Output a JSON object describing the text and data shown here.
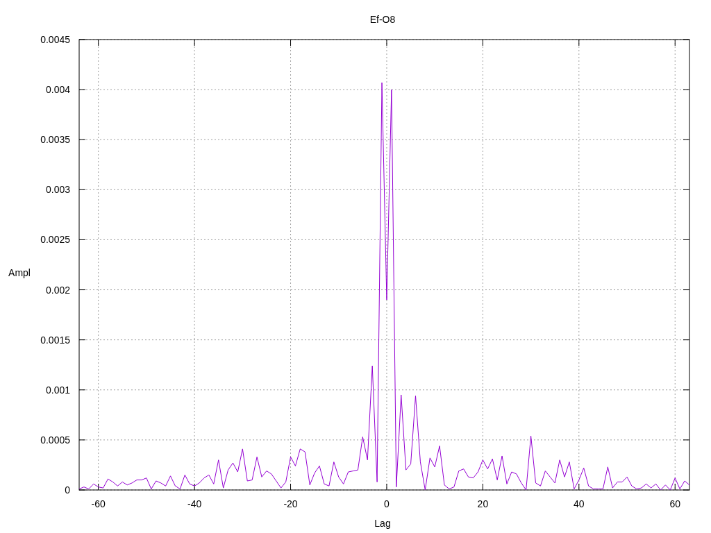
{
  "chart_data": {
    "type": "line",
    "title": "Ef-O8",
    "xlabel": "Lag",
    "ylabel": "Ampl",
    "x": [
      -64,
      -63,
      -62,
      -61,
      -60,
      -59,
      -58,
      -57,
      -56,
      -55,
      -54,
      -53,
      -52,
      -51,
      -50,
      -49,
      -48,
      -47,
      -46,
      -45,
      -44,
      -43,
      -42,
      -41,
      -40,
      -39,
      -38,
      -37,
      -36,
      -35,
      -34,
      -33,
      -32,
      -31,
      -30,
      -29,
      -28,
      -27,
      -26,
      -25,
      -24,
      -23,
      -22,
      -21,
      -20,
      -19,
      -18,
      -17,
      -16,
      -15,
      -14,
      -13,
      -12,
      -11,
      -10,
      -9,
      -8,
      -7,
      -6,
      -5,
      -4,
      -3,
      -2,
      -1,
      0,
      1,
      2,
      3,
      4,
      5,
      6,
      7,
      8,
      9,
      10,
      11,
      12,
      13,
      14,
      15,
      16,
      17,
      18,
      19,
      20,
      21,
      22,
      23,
      24,
      25,
      26,
      27,
      28,
      29,
      30,
      31,
      32,
      33,
      34,
      35,
      36,
      37,
      38,
      39,
      40,
      41,
      42,
      43,
      44,
      45,
      46,
      47,
      48,
      49,
      50,
      51,
      52,
      53,
      54,
      55,
      56,
      57,
      58,
      59,
      60,
      61,
      62,
      63
    ],
    "series": [
      {
        "color": "#9400d3",
        "values": [
          1e-05,
          3e-05,
          1e-05,
          6e-05,
          3e-05,
          2e-05,
          0.00011,
          8e-05,
          4e-05,
          8e-05,
          5e-05,
          7e-05,
          0.0001,
          0.0001,
          0.00012,
          1e-05,
          9e-05,
          7e-05,
          4e-05,
          0.00014,
          4e-05,
          1e-05,
          0.00015,
          6e-05,
          4e-05,
          7e-05,
          0.00012,
          0.00015,
          6e-05,
          0.0003,
          2e-05,
          0.0002,
          0.00027,
          0.00018,
          0.00041,
          9e-05,
          0.0001,
          0.00033,
          0.00013,
          0.00019,
          0.00016,
          9e-05,
          2e-05,
          8e-05,
          0.00033,
          0.00024,
          0.00041,
          0.00038,
          5e-05,
          0.00017,
          0.00024,
          6e-05,
          4e-05,
          0.00028,
          0.00013,
          6e-05,
          0.00018,
          0.00019,
          0.0002,
          0.00053,
          0.0003,
          0.00124,
          8e-05,
          0.00407,
          0.0019,
          0.004,
          3e-05,
          0.00095,
          0.0002,
          0.00026,
          0.00094,
          0.00028,
          0,
          0.00032,
          0.00023,
          0.00044,
          5e-05,
          1e-05,
          3e-05,
          0.00019,
          0.00021,
          0.00013,
          0.00012,
          0.00018,
          0.0003,
          0.00021,
          0.00031,
          0.0001,
          0.00034,
          6e-05,
          0.00018,
          0.00016,
          7e-05,
          0,
          0.00054,
          7e-05,
          4e-05,
          0.00019,
          0.00013,
          7e-05,
          0.0003,
          0.00013,
          0.00028,
          1e-05,
          0.0001,
          0.00022,
          4e-05,
          1e-05,
          1e-05,
          1e-05,
          0.00023,
          2e-05,
          8e-05,
          8e-05,
          0.00013,
          4e-05,
          1e-05,
          2e-05,
          6e-05,
          2e-05,
          6e-05,
          0,
          5e-05,
          0,
          0.00012,
          1e-05,
          9e-05,
          5e-05
        ]
      }
    ],
    "grid": true,
    "xlim": [
      -64,
      63
    ],
    "ylim": [
      0,
      0.0045
    ],
    "xticks": [
      -60,
      -40,
      -20,
      0,
      20,
      40,
      60
    ],
    "yticks": [
      0,
      0.0005,
      0.001,
      0.0015,
      0.002,
      0.0025,
      0.003,
      0.0035,
      0.004,
      0.0045
    ]
  }
}
